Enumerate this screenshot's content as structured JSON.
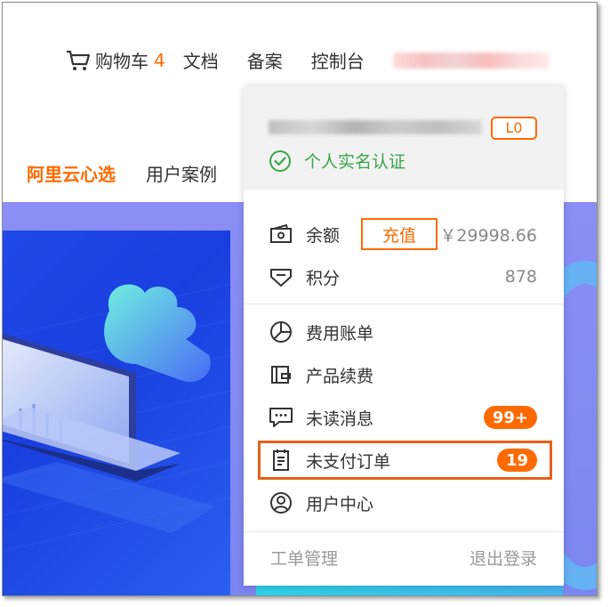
{
  "topnav": {
    "cart_label": "购物车",
    "cart_count": "4",
    "docs": "文档",
    "filing": "备案",
    "console": "控制台"
  },
  "subnav": {
    "active": "阿里云心选",
    "cases": "用户案例"
  },
  "dropdown": {
    "level": "L0",
    "verify": "个人实名认证",
    "balance_label": "余额",
    "recharge": "充值",
    "balance_value": "￥29998.66",
    "points_label": "积分",
    "points_value": "878",
    "menu": [
      {
        "label": "费用账单",
        "icon": "pie-chart-icon"
      },
      {
        "label": "产品续费",
        "icon": "wallet-icon"
      },
      {
        "label": "未读消息",
        "icon": "message-icon",
        "badge": "99+"
      },
      {
        "label": "未支付订单",
        "icon": "order-icon",
        "badge": "19"
      },
      {
        "label": "用户中心",
        "icon": "user-icon"
      }
    ],
    "ticket": "工单管理",
    "logout": "退出登录"
  },
  "colors": {
    "accent": "#ff6a00",
    "verify_green": "#3aa54a",
    "highlight": "#e8601a"
  }
}
